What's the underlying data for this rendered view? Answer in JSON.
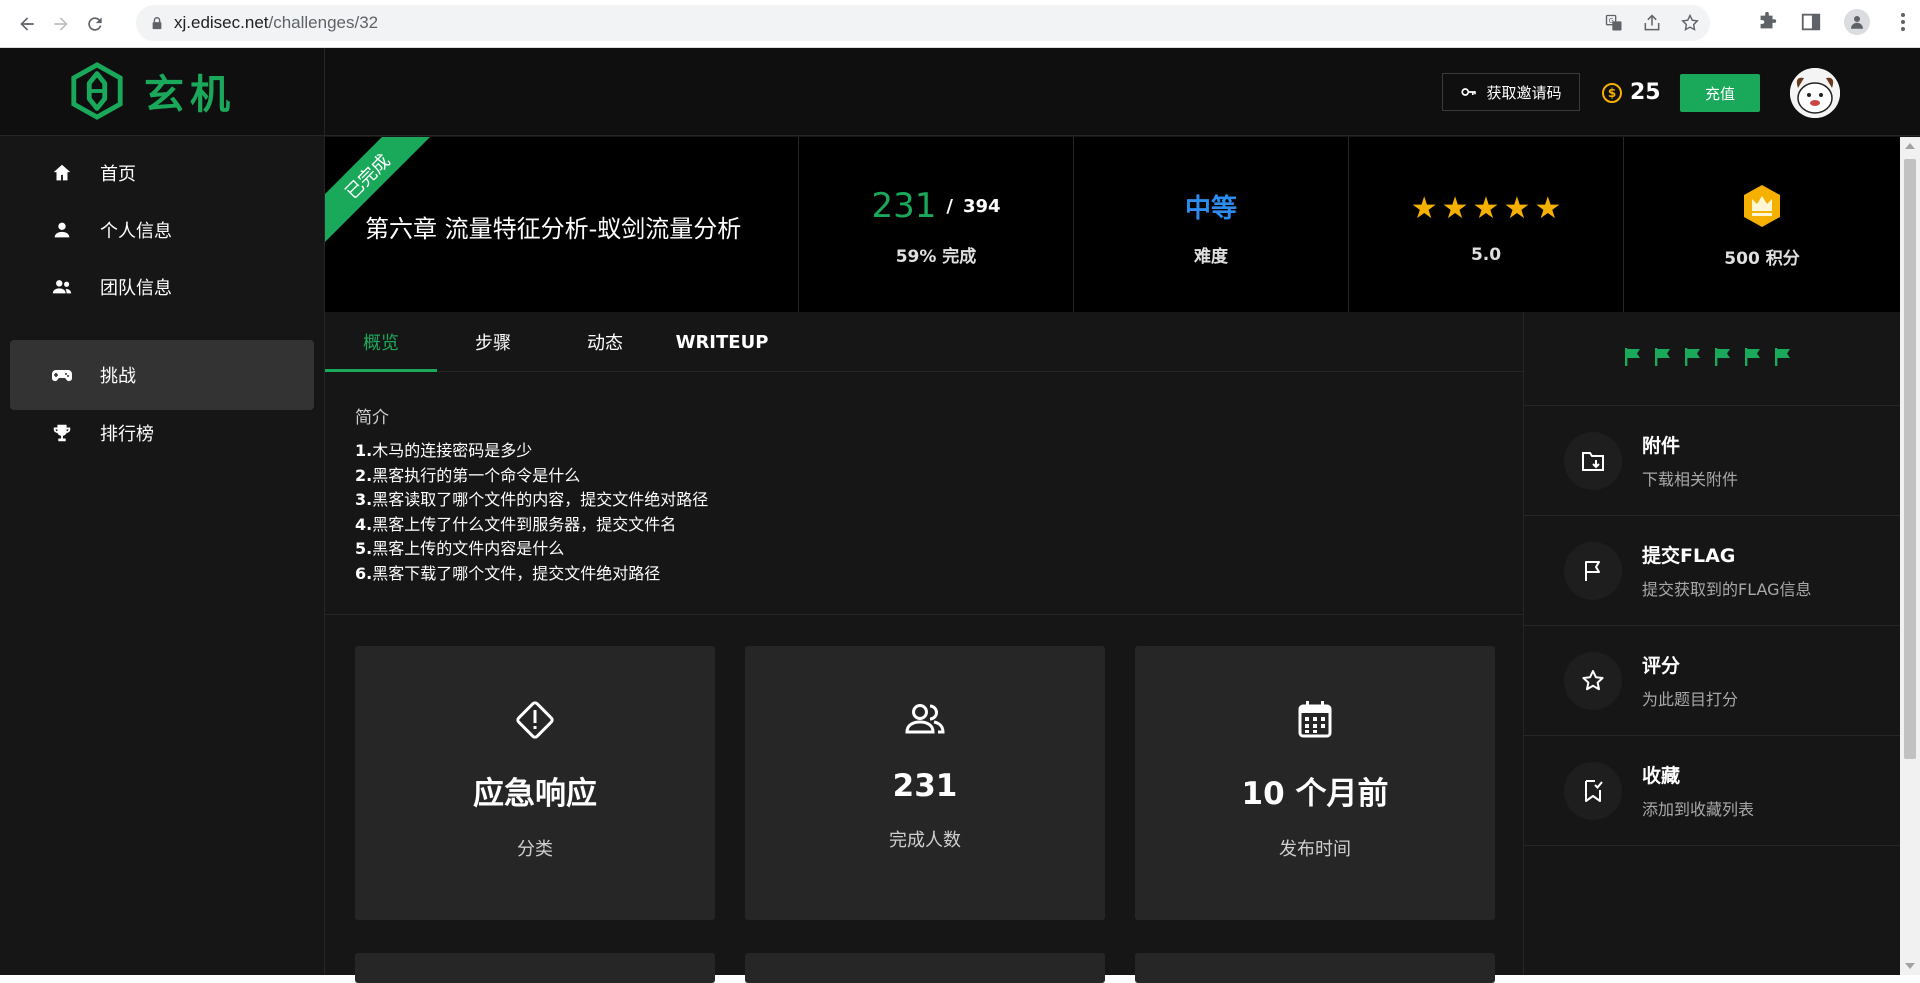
{
  "browser": {
    "url_host": "xj.edisec.net",
    "url_path": "/challenges/32"
  },
  "header": {
    "logo_text": "玄机",
    "invite_label": "获取邀请码",
    "coin_symbol": "$",
    "coin_balance": "25",
    "recharge_label": "充值"
  },
  "sidebar": {
    "items": [
      {
        "label": "首页",
        "icon": "home-icon",
        "active": false
      },
      {
        "label": "个人信息",
        "icon": "person-icon",
        "active": false
      },
      {
        "label": "团队信息",
        "icon": "group-icon",
        "active": false
      },
      {
        "label": "挑战",
        "icon": "gamepad-icon",
        "active": true
      },
      {
        "label": "排行榜",
        "icon": "trophy-icon",
        "active": false
      }
    ]
  },
  "challenge": {
    "status_ribbon": "已完成",
    "title": "第六章 流量特征分析-蚁剑流量分析",
    "solved": "231",
    "slash": "/",
    "total": "394",
    "completion": "59% 完成",
    "difficulty": "中等",
    "difficulty_label": "难度",
    "rating": "5.0",
    "rating_stars": 5,
    "points": "500 积分"
  },
  "tabs": [
    {
      "label": "概览",
      "active": true
    },
    {
      "label": "步骤",
      "active": false
    },
    {
      "label": "动态",
      "active": false
    },
    {
      "label": "WRITEUP",
      "active": false
    }
  ],
  "intro": {
    "heading": "简介",
    "items": [
      {
        "num": "1.",
        "text": "木马的连接密码是多少"
      },
      {
        "num": "2.",
        "text": "黑客执行的第一个命令是什么"
      },
      {
        "num": "3.",
        "text": "黑客读取了哪个文件的内容，提交文件绝对路径"
      },
      {
        "num": "4.",
        "text": "黑客上传了什么文件到服务器，提交文件名"
      },
      {
        "num": "5.",
        "text": "黑客上传的文件内容是什么"
      },
      {
        "num": "6.",
        "text": "黑客下载了哪个文件，提交文件绝对路径"
      }
    ]
  },
  "cards": [
    {
      "value": "应急响应",
      "label": "分类",
      "icon": "diamond-alert-icon"
    },
    {
      "value": "231",
      "label": "完成人数",
      "icon": "users-icon"
    },
    {
      "value": "10 个月前",
      "label": "发布时间",
      "icon": "calendar-icon"
    }
  ],
  "panel": {
    "flag_count": 6,
    "actions": [
      {
        "title": "附件",
        "desc": "下载相关附件",
        "icon": "folder-download-icon"
      },
      {
        "title": "提交FLAG",
        "desc": "提交获取到的FLAG信息",
        "icon": "flag-icon"
      },
      {
        "title": "评分",
        "desc": "为此题目打分",
        "icon": "star-icon"
      },
      {
        "title": "收藏",
        "desc": "添加到收藏列表",
        "icon": "bookmark-check-icon"
      }
    ]
  },
  "colors": {
    "accent_green": "#1aa85a",
    "difficulty_blue": "#2d8cf0",
    "star_gold": "#f5b000",
    "background": "#161616"
  }
}
